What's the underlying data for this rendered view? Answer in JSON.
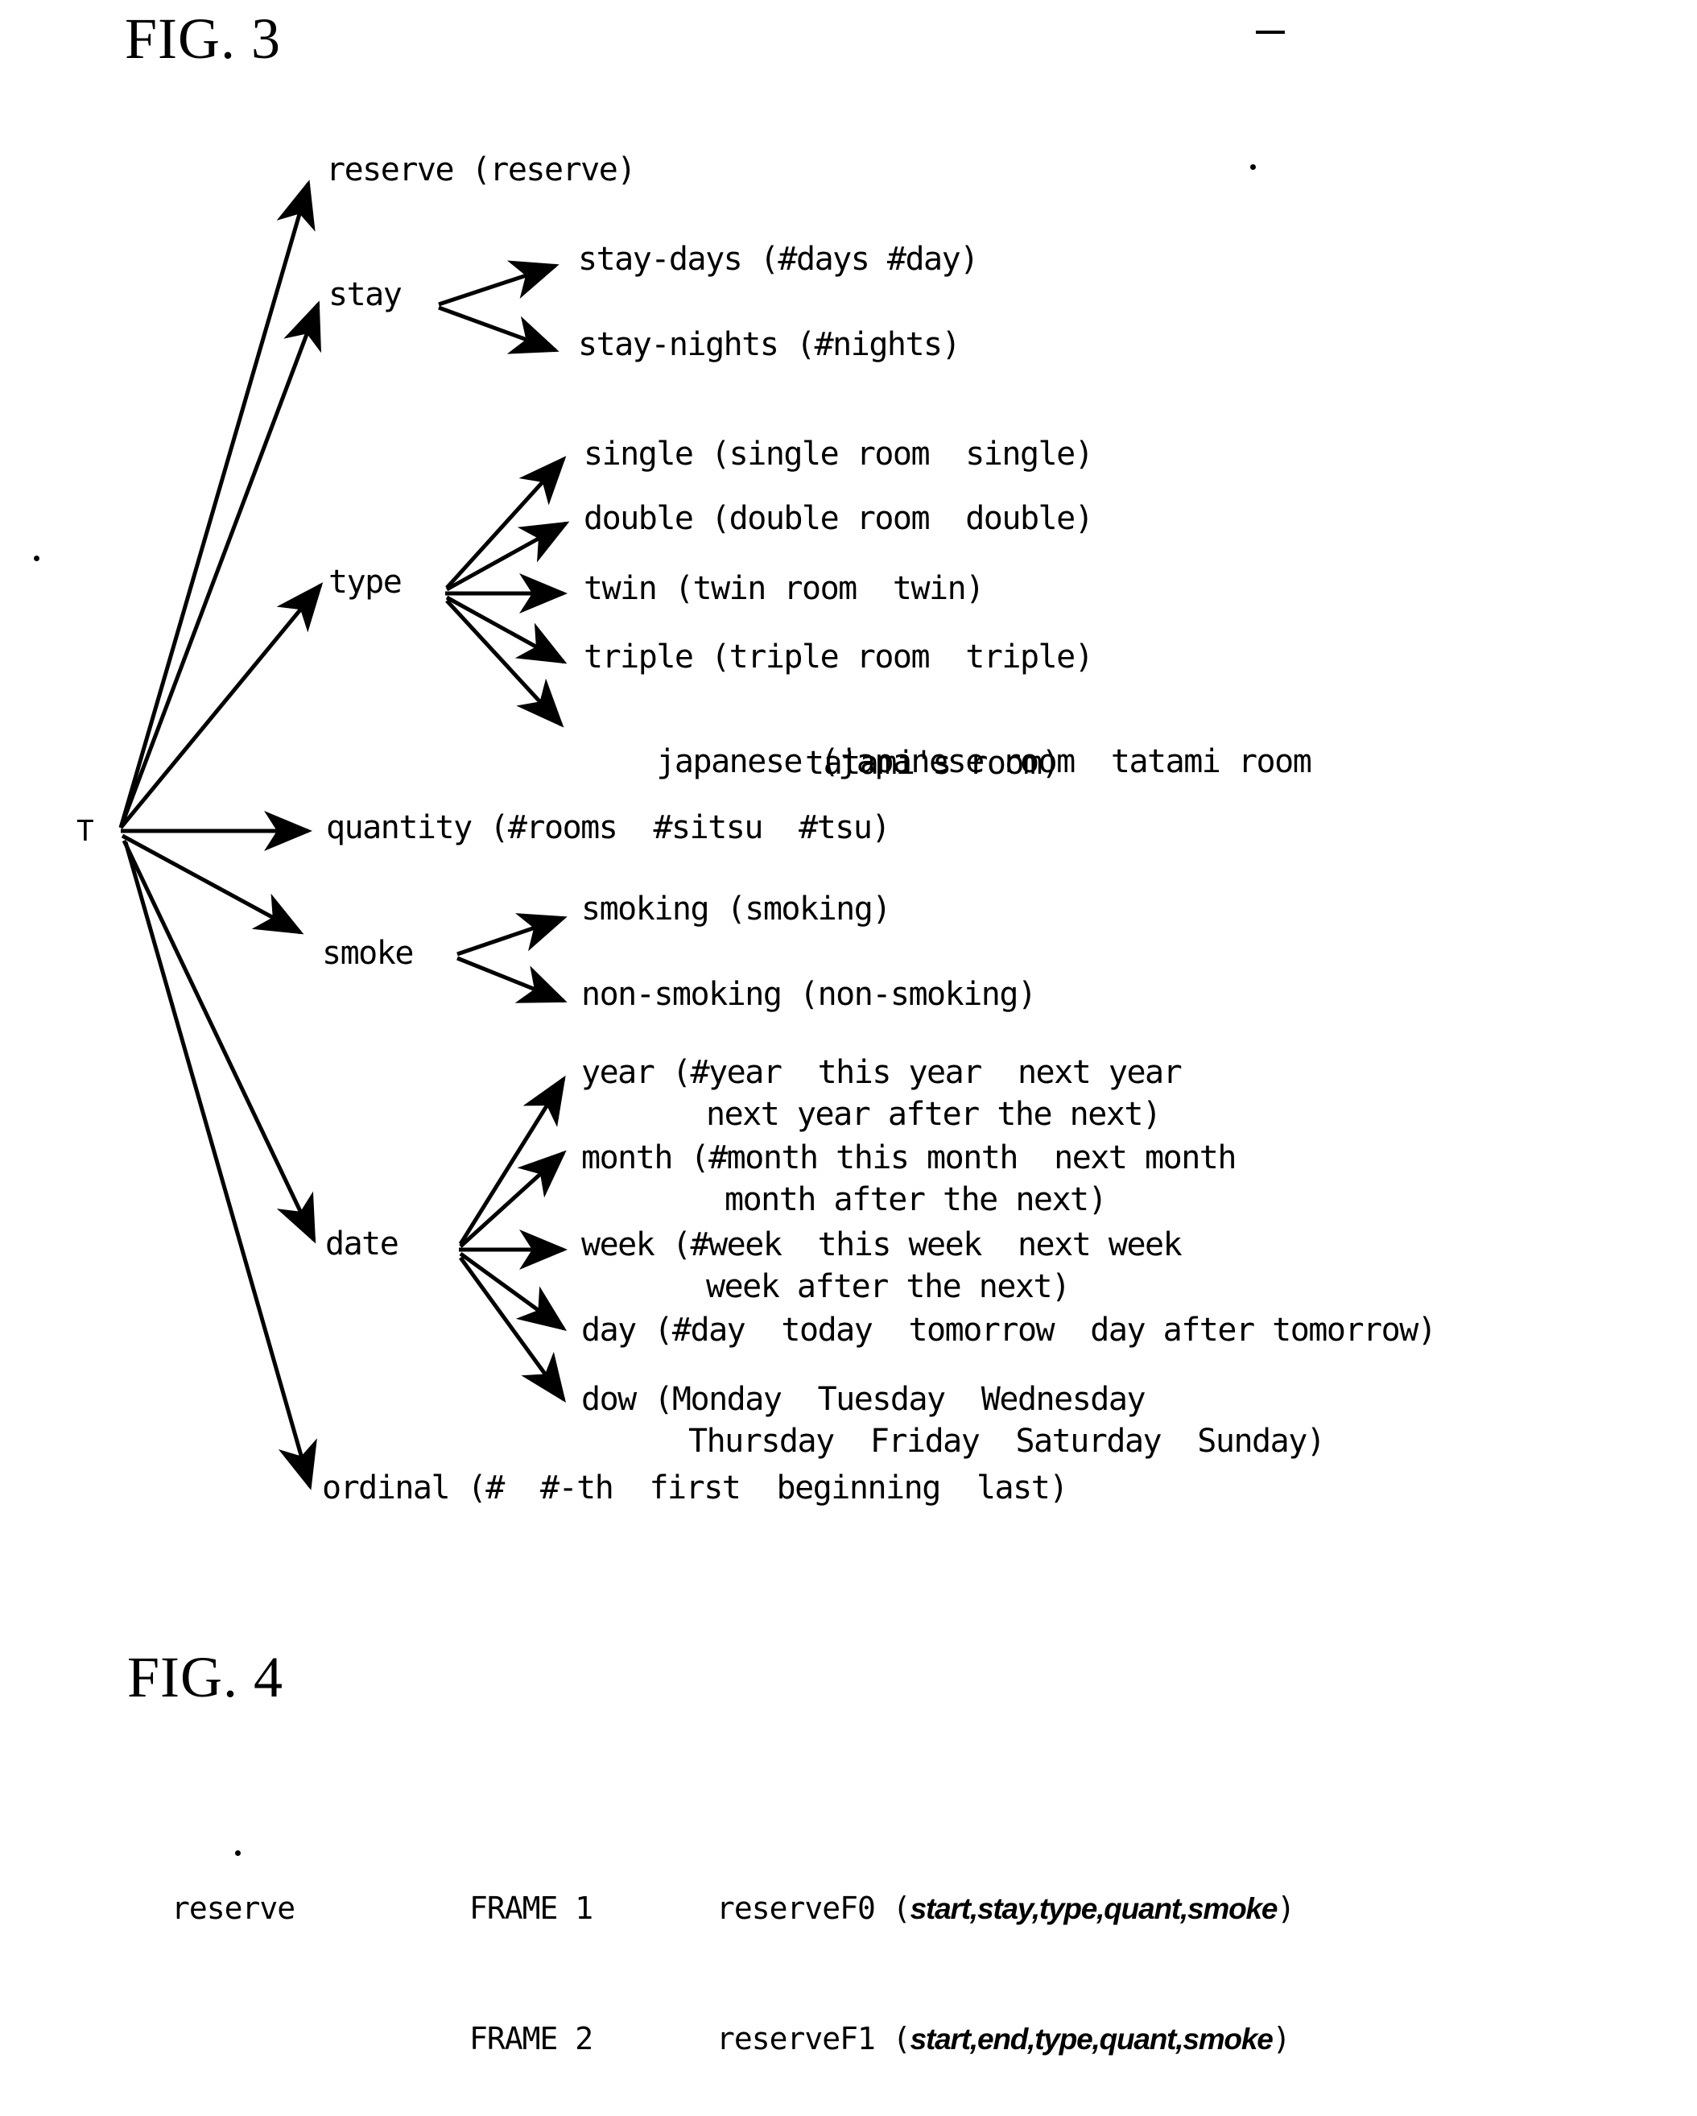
{
  "figures": [
    {
      "id": "fig3",
      "title": "FIG. 3",
      "root": {
        "label": "T"
      },
      "nodes": {
        "reserve": "reserve (reserve)",
        "stay": "stay",
        "stay_days": "stay-days (#days #day)",
        "stay_nights": "stay-nights (#nights)",
        "type": "type",
        "type_single": "single (single room  single)",
        "type_double": "double (double room  double)",
        "type_twin": "twin (twin room  twin)",
        "type_triple": "triple (triple room  triple)",
        "type_japanese_line1": "japanese (japanese room  tatami room",
        "type_japanese_line2": "tatami's room)",
        "quantity": "quantity (#rooms  #sitsu  #tsu)",
        "smoke": "smoke",
        "smoke_smoking": "smoking (smoking)",
        "smoke_non": "non-smoking (non-smoking)",
        "date": "date",
        "date_year_line1": "year (#year  this year  next year",
        "date_year_line2": "next year after the next)",
        "date_month_line1": "month (#month this month  next month",
        "date_month_line2": "month after the next)",
        "date_week_line1": "week (#week  this week  next week",
        "date_week_line2": "week after the next)",
        "date_day": "day (#day  today  tomorrow  day after tomorrow)",
        "date_dow_line1": "dow (Monday  Tuesday  Wednesday",
        "date_dow_line2": "Thursday  Friday  Saturday  Sunday)",
        "ordinal": "ordinal (#  #-th  first  beginning  last)"
      }
    },
    {
      "id": "fig4",
      "title": "FIG. 4",
      "rows": [
        {
          "concept": "reserve",
          "frame": "FRAME 1",
          "func": "reserveF0 (",
          "params": "start,stay,type,quant,smoke",
          "close": ")"
        },
        {
          "concept": "",
          "frame": "FRAME 2",
          "func": "reserveF1 (",
          "params": "start,end,type,quant,smoke",
          "close": ")"
        }
      ]
    }
  ],
  "colors": {
    "ink": "#000000",
    "paper": "#ffffff"
  }
}
